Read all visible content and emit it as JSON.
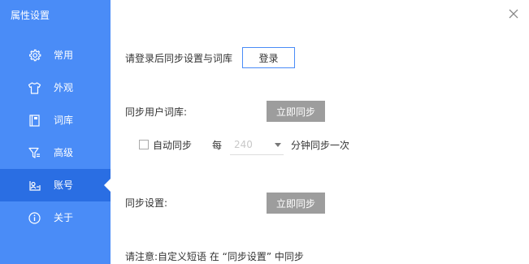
{
  "window": {
    "title": "属性设置"
  },
  "sidebar": {
    "items": [
      {
        "label": "常用",
        "icon": "gear-icon"
      },
      {
        "label": "外观",
        "icon": "shirt-icon"
      },
      {
        "label": "词库",
        "icon": "book-icon"
      },
      {
        "label": "高级",
        "icon": "filter-icon"
      },
      {
        "label": "账号",
        "icon": "id-card-icon",
        "active": true
      },
      {
        "label": "关于",
        "icon": "info-icon"
      }
    ]
  },
  "account": {
    "login_prompt": "请登录后同步设置与词库",
    "login_button": "登录",
    "sync_lexicon_label": "同步用户词库:",
    "sync_now_button": "立即同步",
    "auto_sync_label": "自动同步",
    "every_label": "每",
    "interval_value": "240",
    "interval_suffix": "分钟同步一次",
    "sync_settings_label": "同步设置:",
    "sync_settings_button": "立即同步",
    "note": "请注意:自定义短语 在 “同步设置” 中同步"
  },
  "colors": {
    "sidebar": "#4a8cf7",
    "sidebar_active": "#2a6ee3",
    "button_gray": "#9d9d9d"
  }
}
